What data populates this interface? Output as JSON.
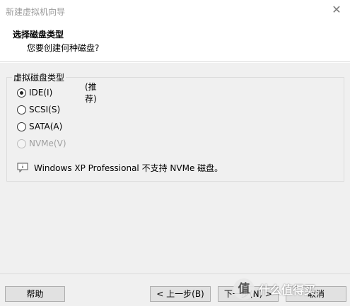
{
  "window": {
    "title": "新建虚拟机向导",
    "close_glyph": "✕"
  },
  "header": {
    "title": "选择磁盘类型",
    "subtitle": "您要创建何种磁盘?"
  },
  "group": {
    "legend": "虚拟磁盘类型",
    "options": [
      {
        "label": "IDE(I)",
        "note": "(推荐)",
        "checked": true,
        "disabled": false
      },
      {
        "label": "SCSI(S)",
        "checked": false,
        "disabled": false
      },
      {
        "label": "SATA(A)",
        "checked": false,
        "disabled": false
      },
      {
        "label": "NVMe(V)",
        "checked": false,
        "disabled": true
      }
    ],
    "info": {
      "icon": "message-icon",
      "text": "Windows XP Professional 不支持 NVMe 磁盘。"
    }
  },
  "footer": {
    "help_label": "帮助",
    "back_label": "< 上一步(B)",
    "next_label": "下一步(N) >",
    "cancel_label": "取消"
  },
  "watermark": {
    "glyph": "值",
    "text": "什么值得买"
  }
}
